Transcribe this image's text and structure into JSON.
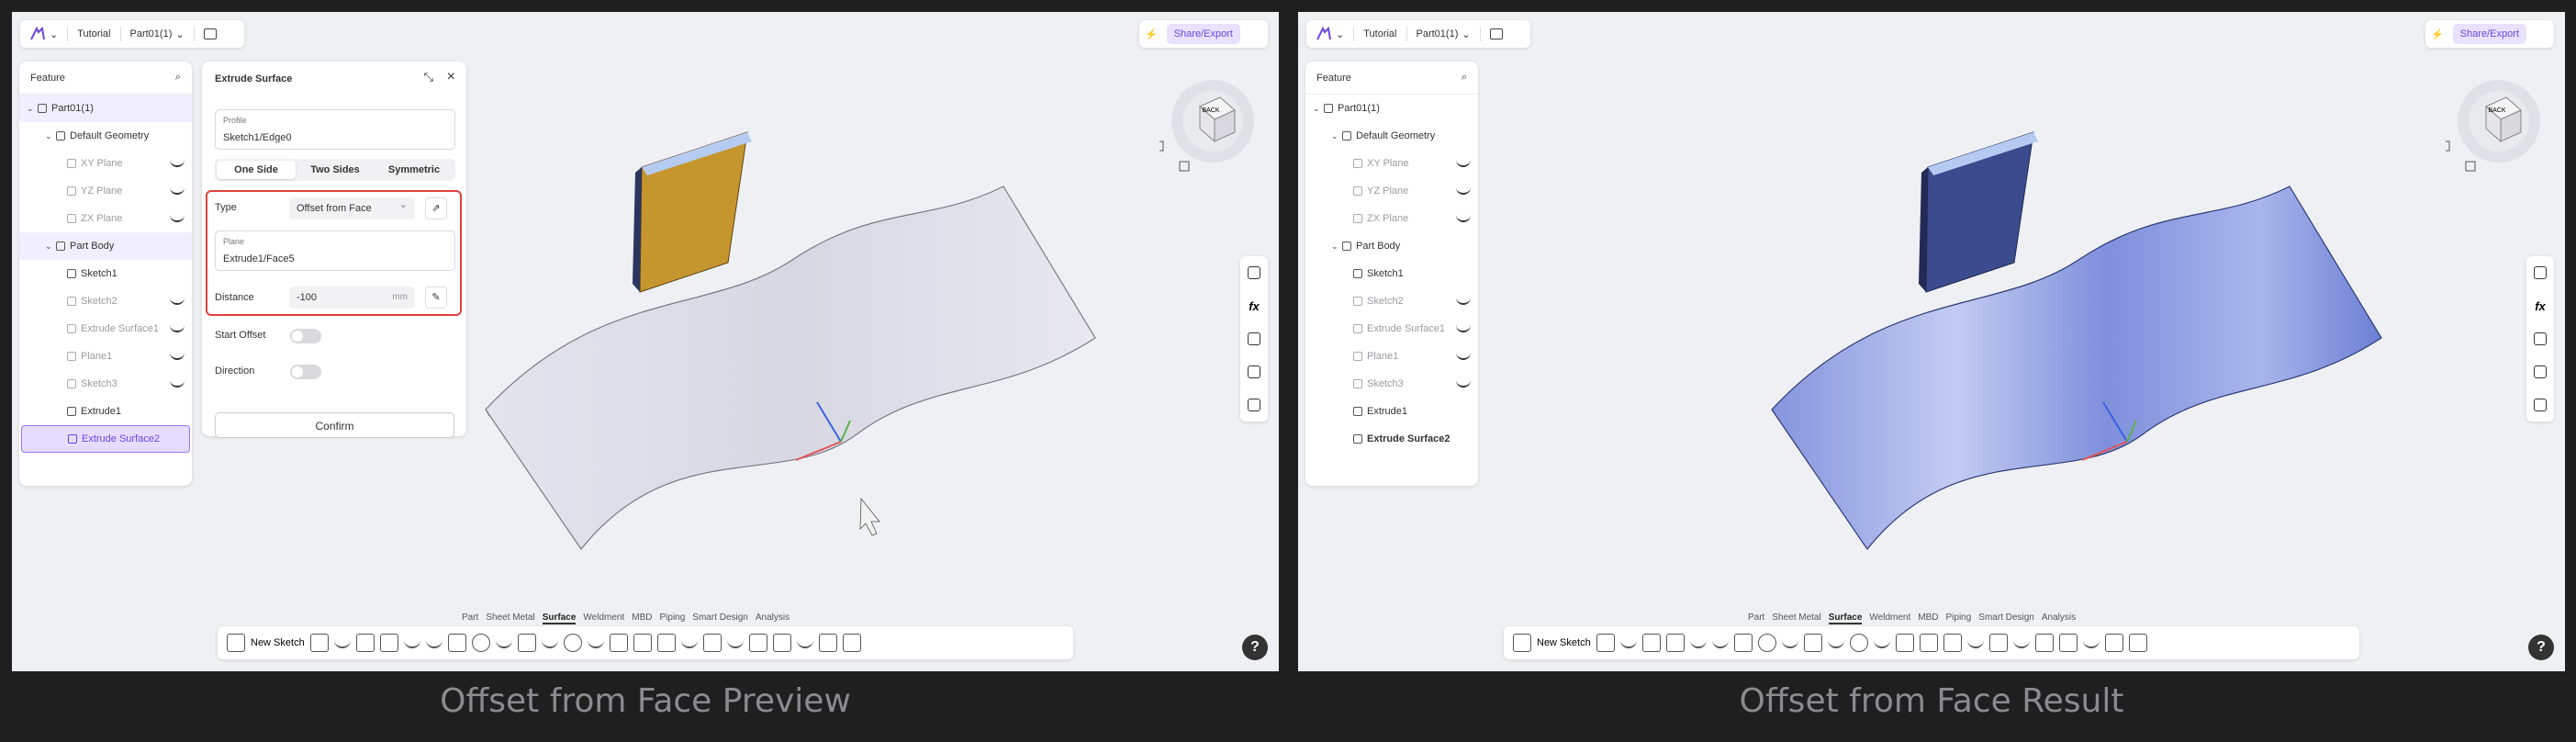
{
  "app": {
    "logo": "app-logo-icon",
    "breadcrumb_1": "Tutorial",
    "document": "Part01(1)",
    "share": "Share/Export"
  },
  "tree": {
    "header": "Feature",
    "items": [
      {
        "label": "Part01(1)"
      },
      {
        "label": "Default Geometry"
      },
      {
        "label": "XY Plane"
      },
      {
        "label": "YZ Plane"
      },
      {
        "label": "ZX Plane"
      },
      {
        "label": "Part Body"
      },
      {
        "label": "Sketch1"
      },
      {
        "label": "Sketch2"
      },
      {
        "label": "Extrude Surface1"
      },
      {
        "label": "Plane1"
      },
      {
        "label": "Sketch3"
      },
      {
        "label": "Extrude1"
      },
      {
        "label": "Extrude Surface2"
      }
    ]
  },
  "panel": {
    "title": "Extrude Surface",
    "profile_label": "Profile",
    "profile_value": "Sketch1/Edge0",
    "modes": [
      "One Side",
      "Two Sides",
      "Symmetric"
    ],
    "type_label": "Type",
    "type_value": "Offset from Face",
    "plane_label": "Plane",
    "plane_value": "Extrude1/Face5",
    "distance_label": "Distance",
    "distance_value": "-100",
    "distance_unit": "mm",
    "start_offset": "Start Offset",
    "direction": "Direction",
    "confirm": "Confirm"
  },
  "tabs": [
    "Part",
    "Sheet Metal",
    "Surface",
    "Weldment",
    "MBD",
    "Piping",
    "Smart Design",
    "Analysis"
  ],
  "active_tab": "Surface",
  "toolbar": {
    "new_sketch": "New Sketch"
  },
  "nav_cube": {
    "label": "BACK"
  },
  "help": "?",
  "captions": {
    "left": "Offset from Face Preview",
    "right": "Offset from Face Result"
  },
  "colors": {
    "accent": "#6b46e0",
    "highlight": "#e0413d",
    "surface_preview": "#dcdde6",
    "surface_result": "#8f9ee0",
    "solid_preview": "#c6962e",
    "solid_result": "#3c4b8e"
  }
}
